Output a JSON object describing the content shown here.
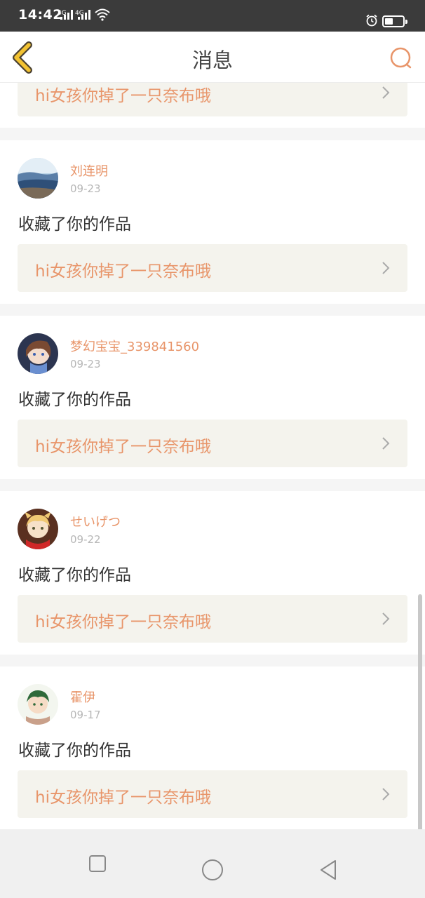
{
  "status_bar": {
    "time": "14:42",
    "signal1": "4G",
    "signal2": "4G"
  },
  "header": {
    "title": "消息",
    "back_icon": "chevron-left-icon",
    "search_icon": "search-icon"
  },
  "messages": [
    {
      "work_title": "hi女孩你掉了一只奈布哦"
    },
    {
      "name": "刘连明",
      "date": "09-23",
      "action": "收藏了你的作品",
      "work_title": "hi女孩你掉了一只奈布哦"
    },
    {
      "name": "梦幻宝宝_339841560",
      "date": "09-23",
      "action": "收藏了你的作品",
      "work_title": "hi女孩你掉了一只奈布哦"
    },
    {
      "name": "せいげつ",
      "date": "09-22",
      "action": "收藏了你的作品",
      "work_title": "hi女孩你掉了一只奈布哦"
    },
    {
      "name": "霍伊",
      "date": "09-17",
      "action": "收藏了你的作品",
      "work_title": "hi女孩你掉了一只奈布哦"
    }
  ],
  "colors": {
    "accent": "#e8956a",
    "back_icon": "#f2c232",
    "work_bg": "#f4f3ed"
  }
}
